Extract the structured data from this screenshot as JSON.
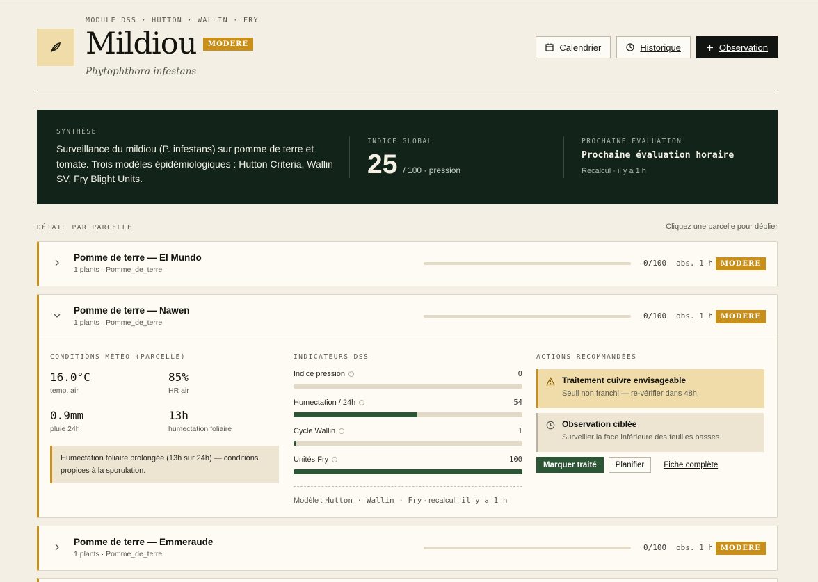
{
  "header": {
    "module": "MODULE DSS · HUTTON · WALLIN · FRY",
    "title": "Mildiou",
    "badge": "MODERE",
    "latin": "Phytophthora infestans",
    "buttons": {
      "calendar": "Calendrier",
      "history": "Historique",
      "observation": "Observation"
    },
    "icons": {
      "logo": "leaf-icon",
      "calendar": "calendar-icon",
      "history": "clock-icon",
      "observation": "plus-icon"
    }
  },
  "synthesis": {
    "label": "SYNTHÈSE",
    "text": "Surveillance du mildiou (P. infestans) sur pomme de terre et tomate. Trois modèles épidémiologiques : Hutton Criteria, Wallin SV, Fry Blight Units.",
    "index_label": "INDICE GLOBAL",
    "index_value": "25",
    "index_suffix": "/ 100 · pression",
    "next_label": "PROCHAINE ÉVALUATION",
    "next_value": "Prochaine évaluation horaire",
    "recalc": "Recalcul · il y a 1 h"
  },
  "detail": {
    "label": "DÉTAIL PAR PARCELLE",
    "hint": "Cliquez une parcelle pour déplier"
  },
  "parcels": [
    {
      "name": "Pomme de terre — El Mundo",
      "sub": "1 plants · Pomme_de_terre",
      "score": "0/100",
      "obs": "obs. 1 h",
      "badge": "MODERE",
      "expanded": false
    },
    {
      "name": "Pomme de terre — Nawen",
      "sub": "1 plants · Pomme_de_terre",
      "score": "0/100",
      "obs": "obs. 1 h",
      "badge": "MODERE",
      "expanded": true
    },
    {
      "name": "Pomme de terre — Emmeraude",
      "sub": "1 plants · Pomme_de_terre",
      "score": "0/100",
      "obs": "obs. 1 h",
      "badge": "MODERE",
      "expanded": false
    }
  ],
  "expanded": {
    "weather": {
      "label": "CONDITIONS MÉTÉO (PARCELLE)",
      "items": [
        {
          "value": "16.0°C",
          "label": "temp. air"
        },
        {
          "value": "85%",
          "label": "HR air"
        },
        {
          "value": "0.9mm",
          "label": "pluie 24h"
        },
        {
          "value": "13h",
          "label": "humectation foliaire"
        }
      ],
      "note": "Humectation foliaire prolongée (13h sur 24h) — conditions propices à la sporulation."
    },
    "indicators": {
      "label": "INDICATEURS DSS",
      "items": [
        {
          "label": "Indice pression",
          "value": "0",
          "fill": 0
        },
        {
          "label": "Humectation / 24h",
          "value": "54",
          "fill": 54
        },
        {
          "label": "Cycle Wallin",
          "value": "1",
          "fill": 1
        },
        {
          "label": "Unités Fry",
          "value": "100",
          "fill": 100
        }
      ],
      "model_prefix": "Modèle :",
      "model_names": "Hutton · Wallin · Fry",
      "model_mid": "· recalcul :",
      "model_time": "il y a 1 h"
    },
    "actions": {
      "label": "ACTIONS RECOMMANDÉES",
      "items": [
        {
          "title": "Traitement cuivre envisageable",
          "desc": "Seuil non franchi — re-vérifier dans 48h.",
          "icon": "warning-icon"
        },
        {
          "title": "Observation ciblée",
          "desc": "Surveiller la face inférieure des feuilles basses.",
          "icon": "clock-icon"
        }
      ],
      "buttons": {
        "mark": "Marquer traité",
        "plan": "Planifier",
        "sheet": "Fiche complète"
      }
    }
  },
  "colors": {
    "accent": "#c8901a",
    "dark": "#12241a",
    "green": "#2c5536",
    "background": "#f3efe4"
  }
}
